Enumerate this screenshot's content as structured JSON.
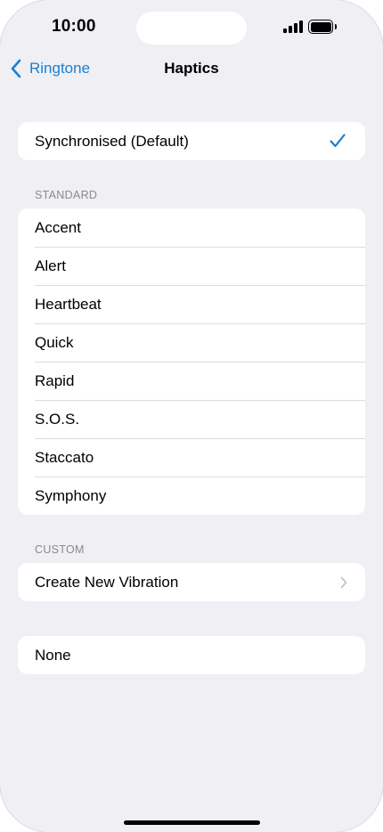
{
  "status_bar": {
    "time": "10:00"
  },
  "nav": {
    "back_label": "Ringtone",
    "title": "Haptics"
  },
  "selected": {
    "label": "Synchronised (Default)"
  },
  "standard": {
    "header": "STANDARD",
    "items": [
      "Accent",
      "Alert",
      "Heartbeat",
      "Quick",
      "Rapid",
      "S.O.S.",
      "Staccato",
      "Symphony"
    ]
  },
  "custom": {
    "header": "CUSTOM",
    "create_label": "Create New Vibration"
  },
  "none": {
    "label": "None"
  },
  "colors": {
    "accent": "#1a7fd4",
    "background": "#efeff4",
    "row": "#ffffff",
    "secondary_text": "#8a8a8e"
  }
}
